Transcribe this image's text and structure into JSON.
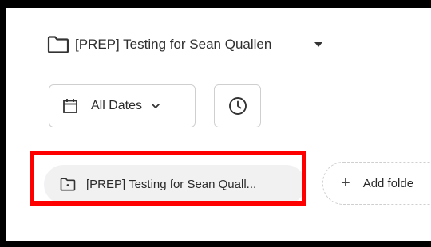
{
  "folder_header": {
    "title": "[PREP] Testing for Sean Quallen",
    "icon": "folder-icon"
  },
  "filters": {
    "date_label": "All Dates",
    "date_icon": "calendar-icon",
    "chevron_icon": "chevron-down-icon",
    "clock_icon": "clock-icon"
  },
  "folders": {
    "chips": [
      {
        "label": "[PREP] Testing for Sean Quall...",
        "icon": "folder-icon"
      }
    ],
    "add_label": "Add folde",
    "add_icon": "plus-icon"
  },
  "colors": {
    "highlight": "#ff0000",
    "chip_bg": "#f1f1f1",
    "border": "#cfcfcf"
  }
}
